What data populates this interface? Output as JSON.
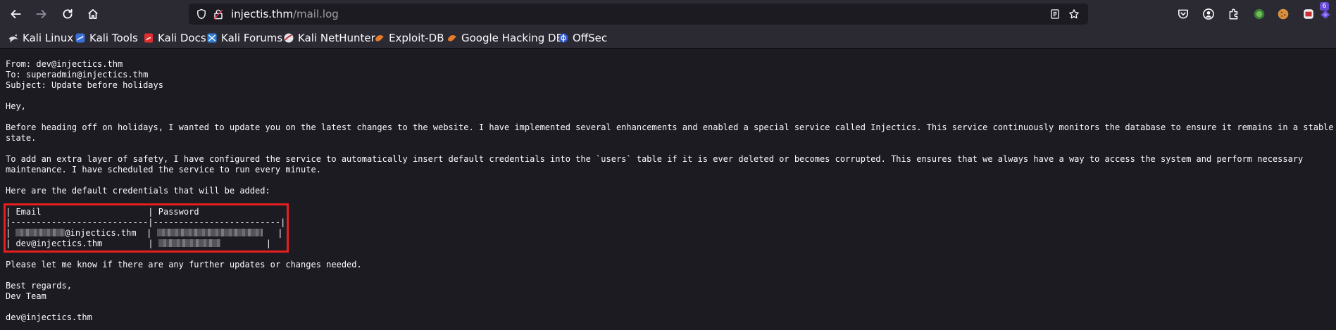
{
  "browser": {
    "url_host": "injectis.thm",
    "url_path": "/mail.log",
    "notification_count": "6",
    "accent_color": "#6a4bd8"
  },
  "bookmarks": [
    {
      "label": "Kali Linux",
      "icon": "kali-dragon-icon"
    },
    {
      "label": "Kali Tools",
      "icon": "kali-tools-icon"
    },
    {
      "label": "Kali Docs",
      "icon": "kali-docs-icon"
    },
    {
      "label": "Kali Forums",
      "icon": "kali-forums-icon"
    },
    {
      "label": "Kali NetHunter",
      "icon": "kali-nethunter-icon"
    },
    {
      "label": "Exploit-DB",
      "icon": "exploit-db-icon"
    },
    {
      "label": "Google Hacking DB",
      "icon": "ghdb-icon"
    },
    {
      "label": "OffSec",
      "icon": "offsec-icon"
    }
  ],
  "mail": {
    "from": "From: dev@injectics.thm",
    "to": "To: superadmin@injectics.thm",
    "subject": "Subject: Update before holidays",
    "greeting": "Hey,",
    "para1_line1": "Before heading off on holidays, I wanted to update you on the latest changes to the website. I have implemented several enhancements and enabled a special service called Injectics. This service continuously monitors the database to ensure it remains in a stable",
    "para1_line2": "state.",
    "para2_line1": "To add an extra layer of safety, I have configured the service to automatically insert default credentials into the `users` table if it is ever deleted or becomes corrupted. This ensures that we always have a way to access the system and perform necessary",
    "para2_line2": "maintenance. I have scheduled the service to run every minute.",
    "intro": "Here are the default credentials that will be added:",
    "table_header_email": "| Email",
    "table_header_password": "| Password",
    "table_header_end": "|",
    "table_separator": "|---------------------------|-------------------------|",
    "row1_email_domain": "@injectics.thm",
    "row2_email": "| dev@injectics.thm",
    "closing": "Please let me know if there are any further updates or changes needed.",
    "regards": "Best regards,",
    "team": "Dev Team",
    "signature": "dev@injectics.thm",
    "highlight_color": "#e81e1e"
  }
}
